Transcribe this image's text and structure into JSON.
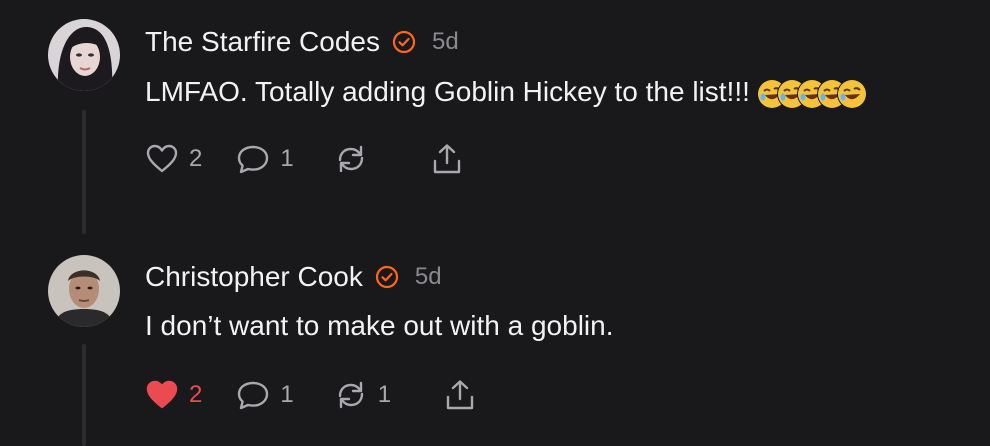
{
  "comments": [
    {
      "author": "The Starfire Codes",
      "time": "5d",
      "text": "LMFAO. Totally adding Goblin Hickey to the list!!!",
      "emoji": [
        "rolling-on-floor-laughing",
        "rolling-on-floor-laughing",
        "rolling-on-floor-laughing",
        "rolling-on-floor-laughing",
        "rolling-on-floor-laughing"
      ],
      "likes": "2",
      "replies": "1",
      "restacks": "",
      "liked": false
    },
    {
      "author": "Christopher Cook",
      "time": "5d",
      "text": "I don’t want to make out with a goblin.",
      "likes": "2",
      "replies": "1",
      "restacks": "1",
      "liked": true
    }
  ],
  "colors": {
    "background": "#19191b",
    "accent": "#ff6719",
    "liked": "#ea4b51",
    "muted": "#8a8a8e"
  },
  "icons": [
    "heart-icon",
    "comment-icon",
    "restack-icon",
    "share-icon",
    "verified-badge-icon"
  ]
}
